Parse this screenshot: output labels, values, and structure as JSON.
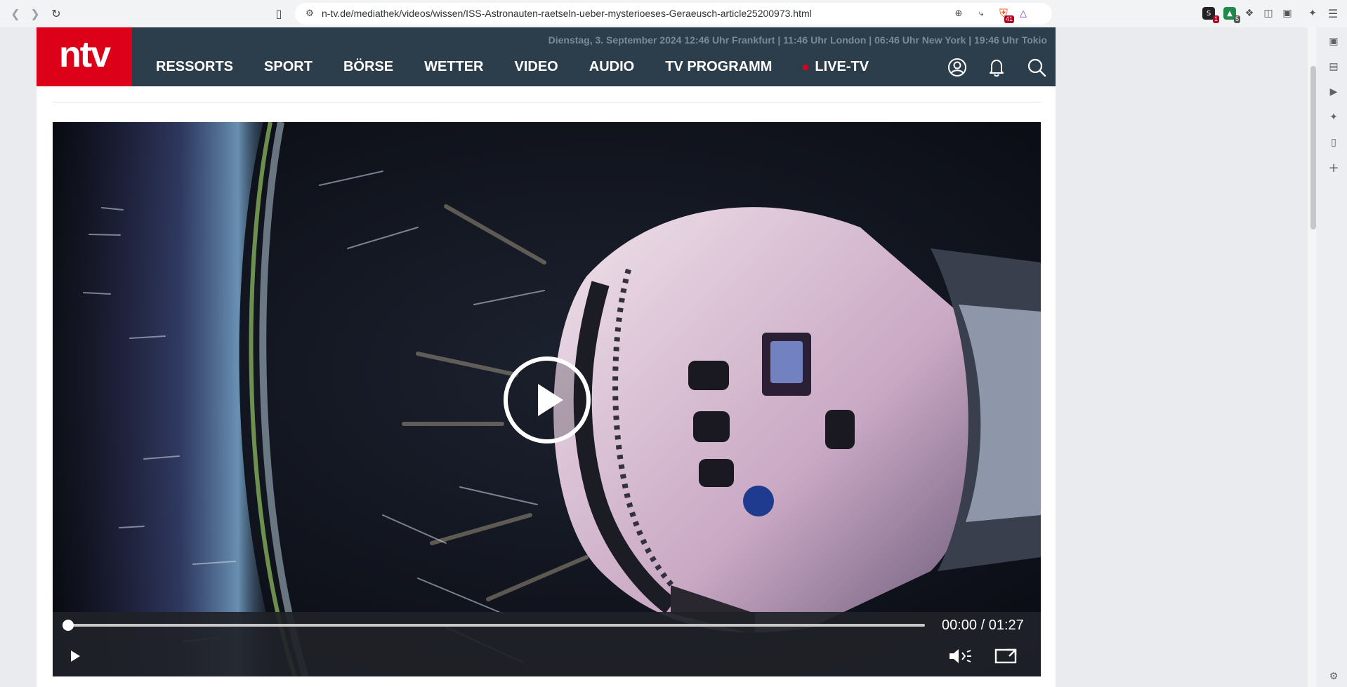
{
  "browser": {
    "url": "n-tv.de/mediathek/videos/wissen/ISS-Astronauten-raetseln-ueber-mysterioeses-Geraeusch-article25200973.html",
    "extension_badges": {
      "first": "1",
      "second": "5",
      "brave": "41"
    }
  },
  "header": {
    "logo_text": "ntv",
    "dateline": "Dienstag, 3. September 2024 12:46 Uhr Frankfurt | 11:46 Uhr London | 06:46 Uhr New York | 19:46 Uhr Tokio",
    "menu": [
      "RESSORTS",
      "SPORT",
      "BÖRSE",
      "WETTER",
      "VIDEO",
      "AUDIO",
      "TV PROGRAMM"
    ],
    "live_label": "LIVE-TV",
    "icons": [
      "user-icon",
      "bell-icon",
      "search-icon"
    ]
  },
  "video": {
    "current_time": "00:00",
    "duration": "01:27",
    "time_display": "00:00 / 01:27",
    "progress": 0
  },
  "colors": {
    "brand_red": "#dc0019",
    "header_bg": "#2c3d4b"
  }
}
